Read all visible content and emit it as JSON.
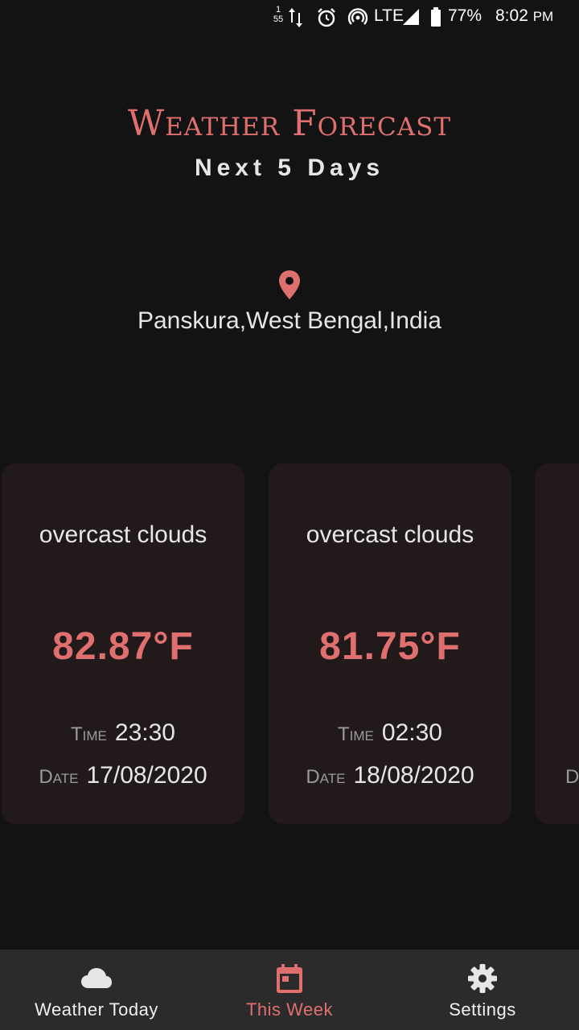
{
  "status_bar": {
    "notif_count_top": "1",
    "notif_count_bottom": "55",
    "network": "LTE",
    "battery": "77%",
    "time": "8:02",
    "ampm": "PM"
  },
  "header": {
    "title": "Weather Forecast",
    "subtitle": "Next 5 Days"
  },
  "location": {
    "text": "Panskura,West Bengal,India"
  },
  "forecast_cards": [
    {
      "condition": "overcast clouds",
      "temp": "82.87°F",
      "time_label": "Time",
      "time": "23:30",
      "date_label": "Date",
      "date": "17/08/2020"
    },
    {
      "condition": "overcast clouds",
      "temp": "81.75°F",
      "time_label": "Time",
      "time": "02:30",
      "date_label": "Date",
      "date": "18/08/2020"
    },
    {
      "date_label": "Da"
    }
  ],
  "bottom_nav": [
    {
      "label": "Weather Today",
      "icon": "cloud-icon",
      "active": false
    },
    {
      "label": "This Week",
      "icon": "calendar-icon",
      "active": true
    },
    {
      "label": "Settings",
      "icon": "gear-icon",
      "active": false
    }
  ],
  "colors": {
    "accent": "#e07070",
    "background": "#131313",
    "card": "#221a1a",
    "nav": "#2b2b2b"
  }
}
